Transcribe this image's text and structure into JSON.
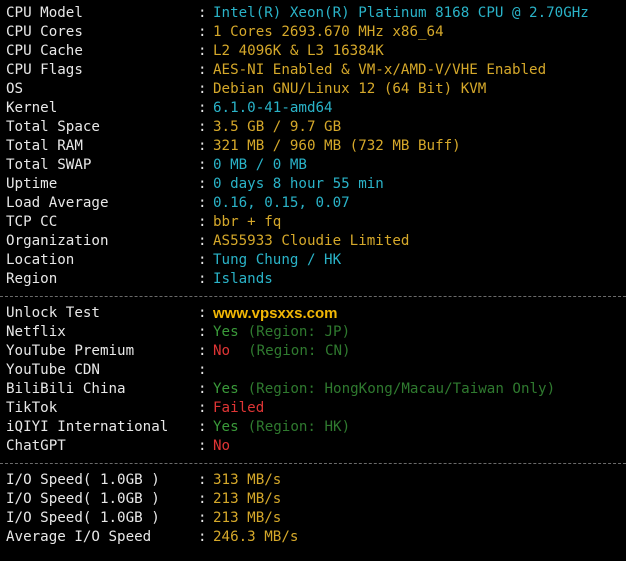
{
  "colors": {
    "background": "#000000",
    "label": "#e8e8e8",
    "cyan": "#2ab3c8",
    "yellow": "#d5a82a",
    "green": "#3a9a3a",
    "red": "#e03535",
    "watermark": "#f2b705"
  },
  "system": [
    {
      "label": "CPU Model",
      "value": "Intel(R) Xeon(R) Platinum 8168 CPU @ 2.70GHz",
      "color": "cyan"
    },
    {
      "label": "CPU Cores",
      "value": "1 Cores 2693.670 MHz x86_64",
      "color": "yellow"
    },
    {
      "label": "CPU Cache",
      "value": "L2 4096K & L3 16384K",
      "color": "yellow"
    },
    {
      "label": "CPU Flags",
      "value": "AES-NI Enabled & VM-x/AMD-V/VHE Enabled",
      "color": "yellow"
    },
    {
      "label": "OS",
      "value": "Debian GNU/Linux 12 (64 Bit) KVM",
      "color": "yellow"
    },
    {
      "label": "Kernel",
      "value": "6.1.0-41-amd64",
      "color": "cyan"
    },
    {
      "label": "Total Space",
      "value": "3.5 GB / 9.7 GB",
      "color": "yellow"
    },
    {
      "label": "Total RAM",
      "value": "321 MB / 960 MB (732 MB Buff)",
      "color": "yellow"
    },
    {
      "label": "Total SWAP",
      "value": "0 MB / 0 MB",
      "color": "cyan"
    },
    {
      "label": "Uptime",
      "value": "0 days 8 hour 55 min",
      "color": "cyan"
    },
    {
      "label": "Load Average",
      "value": "0.16, 0.15, 0.07",
      "color": "cyan"
    },
    {
      "label": "TCP CC",
      "value": "bbr + fq",
      "color": "yellow"
    },
    {
      "label": "Organization",
      "value": "AS55933 Cloudie Limited",
      "color": "yellow"
    },
    {
      "label": "Location",
      "value": "Tung Chung / HK",
      "color": "cyan"
    },
    {
      "label": "Region",
      "value": "Islands",
      "color": "cyan"
    }
  ],
  "unlock": {
    "title": "Unlock Test",
    "watermark": "www.vpsxxs.com",
    "items": [
      {
        "label": "Netflix",
        "status": "Yes",
        "status_color": "green",
        "region": "(Region: JP)"
      },
      {
        "label": "YouTube Premium",
        "status": "No",
        "status_color": "red",
        "region": "(Region: CN)"
      },
      {
        "label": "YouTube CDN",
        "status": "",
        "status_color": "green",
        "region": ""
      },
      {
        "label": "BiliBili China",
        "status": "Yes",
        "status_color": "green",
        "region": "(Region: HongKong/Macau/Taiwan Only)"
      },
      {
        "label": "TikTok",
        "status": "Failed",
        "status_color": "red",
        "region": ""
      },
      {
        "label": "iQIYI International",
        "status": "Yes",
        "status_color": "green",
        "region": "(Region: HK)"
      },
      {
        "label": "ChatGPT",
        "status": "No",
        "status_color": "red",
        "region": ""
      }
    ]
  },
  "io": [
    {
      "label": "I/O Speed( 1.0GB )",
      "value": "313 MB/s"
    },
    {
      "label": "I/O Speed( 1.0GB )",
      "value": "213 MB/s"
    },
    {
      "label": "I/O Speed( 1.0GB )",
      "value": "213 MB/s"
    },
    {
      "label": "Average I/O Speed",
      "value": "246.3 MB/s"
    }
  ],
  "colon": ":"
}
